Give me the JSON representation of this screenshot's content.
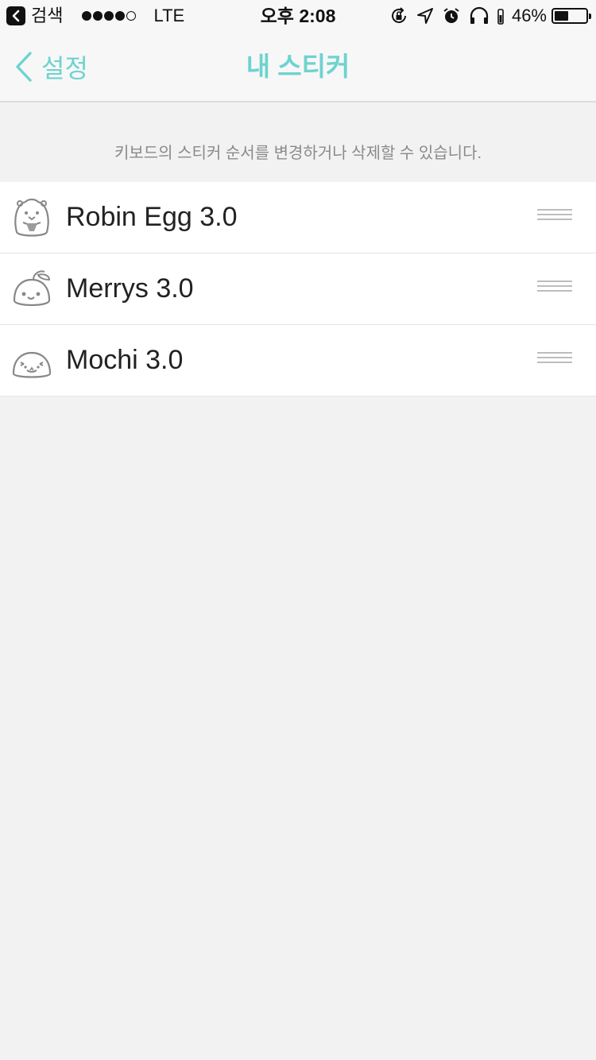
{
  "status_bar": {
    "back_app": "검색",
    "carrier": "LTE",
    "time": "오후 2:08",
    "battery": "46%",
    "battery_level": 0.46
  },
  "nav": {
    "back_label": "설정",
    "title": "내 스티커"
  },
  "hint": "키보드의 스티커 순서를 변경하거나 삭제할 수 있습니다.",
  "stickers": [
    {
      "name": "Robin Egg 3.0",
      "icon": "robin-egg-icon"
    },
    {
      "name": "Merrys 3.0",
      "icon": "merrys-icon"
    },
    {
      "name": "Mochi 3.0",
      "icon": "mochi-icon"
    }
  ],
  "colors": {
    "accent": "#6ed3cf",
    "background": "#f2f2f2"
  }
}
